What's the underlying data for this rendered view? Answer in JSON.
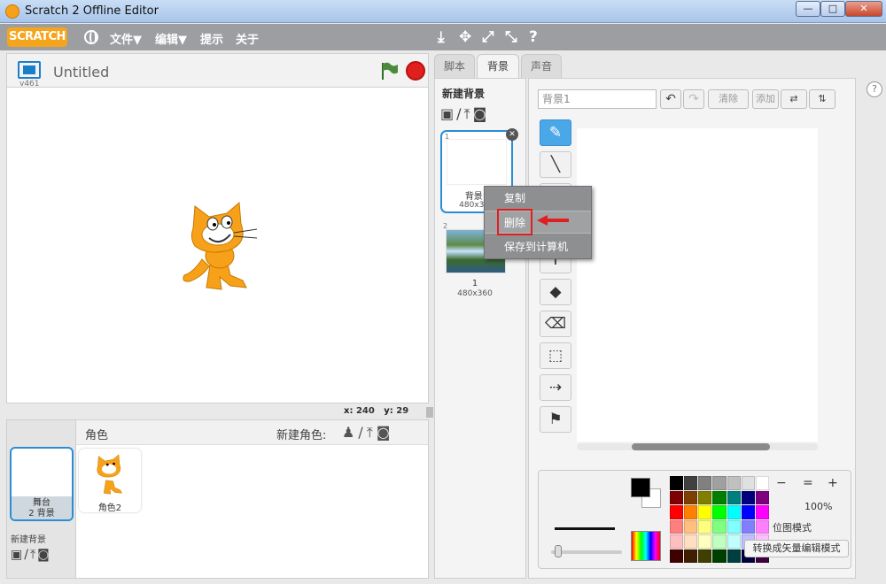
{
  "window": {
    "title": "Scratch 2 Offline Editor",
    "minimize": "—",
    "maximize": "□",
    "close": "✕"
  },
  "menubar": {
    "logo": "SCRATCH",
    "items": [
      "文件▼",
      "编辑▼",
      "提示",
      "关于"
    ],
    "tools": [
      "⤓",
      "✥",
      "⤢",
      "⤡",
      "?"
    ]
  },
  "stage": {
    "project_title": "Untitled",
    "version": "v461",
    "coords": {
      "x_label": "x:",
      "x": "240",
      "y_label": "y:",
      "y": "29"
    }
  },
  "sprites": {
    "title": "角色",
    "new_sprite_label": "新建角色:",
    "new_sprite_icons": "♟/⤒◙",
    "stage_thumb": {
      "line1": "舞台",
      "line2": "2 背景"
    },
    "new_backdrop_label": "新建背景",
    "new_backdrop_icons": "▣/⤒◙",
    "items": [
      {
        "label": "角色2"
      }
    ]
  },
  "tabs": {
    "scripts": "脚本",
    "backdrops": "背景",
    "sounds": "声音"
  },
  "backdrop_list": {
    "new_backdrop": "新建背景",
    "icons": "▣/⤒◙",
    "items": [
      {
        "num": "1",
        "name": "背景1",
        "size": "480x360"
      },
      {
        "num": "2",
        "name": "1",
        "size": "480x360"
      }
    ]
  },
  "context_menu": {
    "copy": "复制",
    "delete": "删除",
    "save": "保存到计算机"
  },
  "editor": {
    "name_placeholder": "背景1",
    "undo": "↶",
    "redo": "↷",
    "clear": "清除",
    "add": "添加",
    "flip_h": "⇄",
    "flip_v": "⇅",
    "tools": [
      "✎",
      "╲",
      "▭",
      "◯",
      "T",
      "◆",
      "⌫",
      "⬚",
      "⇢",
      "⚑"
    ],
    "zoom_level": "100%",
    "zoom_buttons": [
      "−",
      "=",
      "+"
    ],
    "bitmap_mode": "位图模式",
    "convert_button": "转换成矢量编辑模式",
    "palette": [
      "#000000",
      "#404040",
      "#808080",
      "#a0a0a0",
      "#c0c0c0",
      "#e0e0e0",
      "#ffffff",
      "#7f0000",
      "#7f3f00",
      "#7f7f00",
      "#007f00",
      "#007f7f",
      "#00007f",
      "#7f007f",
      "#ff0000",
      "#ff7f00",
      "#ffff00",
      "#00ff00",
      "#00ffff",
      "#0000ff",
      "#ff00ff",
      "#ff7f7f",
      "#ffbf7f",
      "#ffff7f",
      "#7fff7f",
      "#7fffff",
      "#7f7fff",
      "#ff7fff",
      "#ffbfbf",
      "#ffdfbf",
      "#ffffbf",
      "#bfffbf",
      "#bfffff",
      "#bfbfff",
      "#ffbfff",
      "#3f0000",
      "#3f1f00",
      "#3f3f00",
      "#003f00",
      "#003f3f",
      "#00003f",
      "#3f003f"
    ]
  },
  "help": "?",
  "colors": {
    "accent": "#2a8dd6",
    "menubar": "#9c9ea2",
    "stop": "#e0201e",
    "flag": "#4a8a3a",
    "highlight": "#e02020"
  }
}
